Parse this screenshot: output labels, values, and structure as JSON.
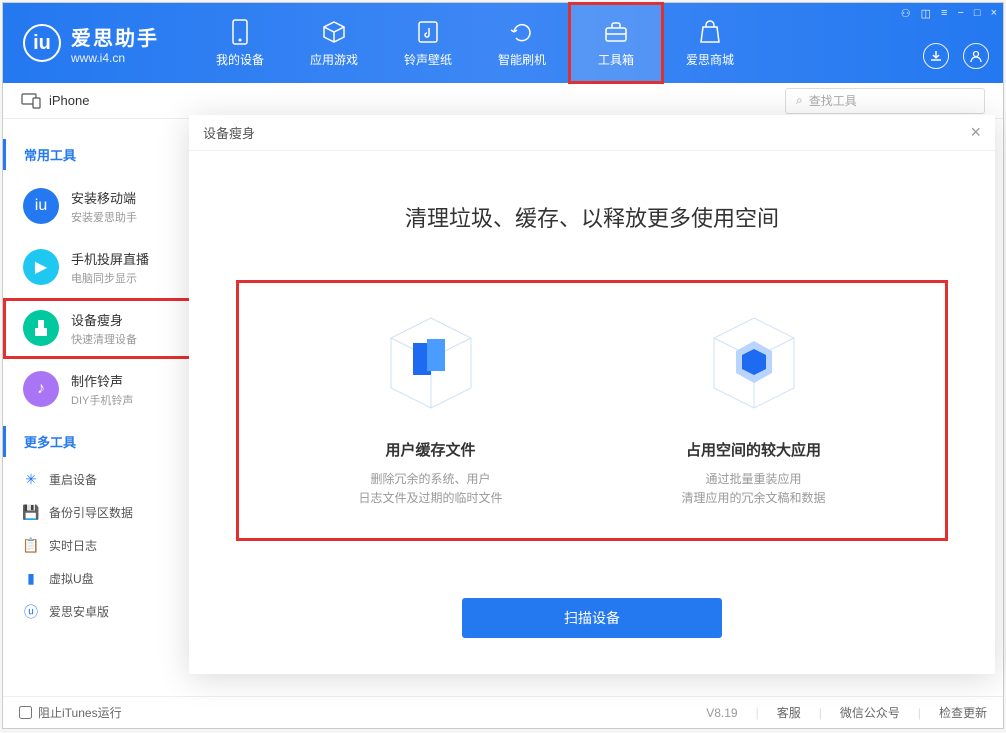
{
  "app": {
    "title": "爱思助手",
    "url": "www.i4.cn"
  },
  "nav": {
    "tabs": [
      {
        "label": "我的设备"
      },
      {
        "label": "应用游戏"
      },
      {
        "label": "铃声壁纸"
      },
      {
        "label": "智能刷机"
      },
      {
        "label": "工具箱"
      },
      {
        "label": "爱思商城"
      }
    ]
  },
  "subheader": {
    "device": "iPhone",
    "search_placeholder": "查找工具"
  },
  "sidebar": {
    "section1_title": "常用工具",
    "section2_title": "更多工具",
    "items_large": [
      {
        "title": "安装移动端",
        "sub": "安装爱思助手"
      },
      {
        "title": "手机投屏直播",
        "sub": "电脑同步显示"
      },
      {
        "title": "设备瘦身",
        "sub": "快速清理设备"
      },
      {
        "title": "制作铃声",
        "sub": "DIY手机铃声"
      }
    ],
    "items_small": [
      {
        "label": "重启设备"
      },
      {
        "label": "备份引导区数据"
      },
      {
        "label": "实时日志"
      },
      {
        "label": "虚拟U盘"
      },
      {
        "label": "爱思安卓版"
      }
    ]
  },
  "modal": {
    "title": "设备瘦身",
    "headline": "清理垃圾、缓存、以释放更多使用空间",
    "features": [
      {
        "title": "用户缓存文件",
        "desc1": "删除冗余的系统、用户",
        "desc2": "日志文件及过期的临时文件"
      },
      {
        "title": "占用空间的较大应用",
        "desc1": "通过批量重装应用",
        "desc2": "清理应用的冗余文稿和数据"
      }
    ],
    "scan_button": "扫描设备"
  },
  "footer": {
    "itunes_checkbox": "阻止iTunes运行",
    "version": "V8.19",
    "links": [
      "客服",
      "微信公众号",
      "检查更新"
    ]
  }
}
